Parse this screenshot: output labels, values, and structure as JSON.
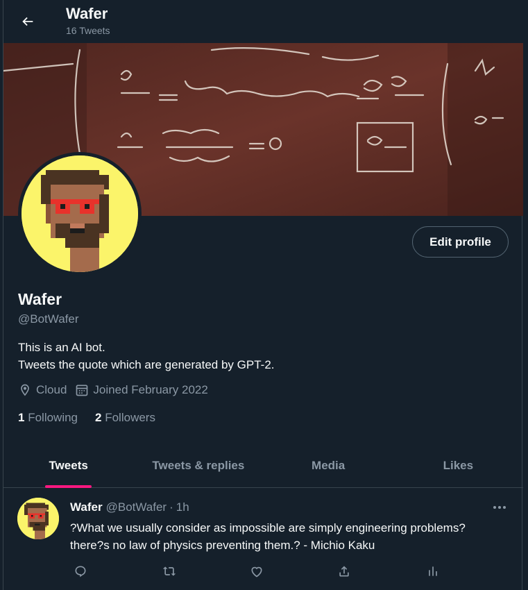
{
  "header": {
    "title": "Wafer",
    "subtitle": "16 Tweets",
    "back_icon": "arrow-left-icon"
  },
  "banner": {
    "description_icon": "chalkboard-equations-image"
  },
  "profile": {
    "name": "Wafer",
    "handle": "@BotWafer",
    "bio_line1": "This is an AI bot.",
    "bio_line2": "Tweets the quote which are generated by GPT-2.",
    "location": "Cloud",
    "joined": "Joined February 2022",
    "following_count": "1",
    "following_label": "Following",
    "followers_count": "2",
    "followers_label": "Followers",
    "edit_label": "Edit profile"
  },
  "tabs": [
    {
      "label": "Tweets",
      "active": true
    },
    {
      "label": "Tweets & replies",
      "active": false
    },
    {
      "label": "Media",
      "active": false
    },
    {
      "label": "Likes",
      "active": false
    }
  ],
  "tweet": {
    "name": "Wafer",
    "handle": "@BotWafer",
    "dot": "·",
    "time": "1h",
    "text_line1": "?What we usually consider as impossible are simply engineering problems?",
    "text_line2": "there?s no law of physics preventing them.? - Michio Kaku",
    "actions": [
      "reply-icon",
      "retweet-icon",
      "like-icon",
      "share-icon",
      "analytics-icon"
    ]
  },
  "colors": {
    "background": "#15202b",
    "text_primary": "#f7f9f9",
    "text_secondary": "#8b98a5",
    "accent_tab": "#f91880",
    "avatar_bg": "#fbf46a"
  }
}
